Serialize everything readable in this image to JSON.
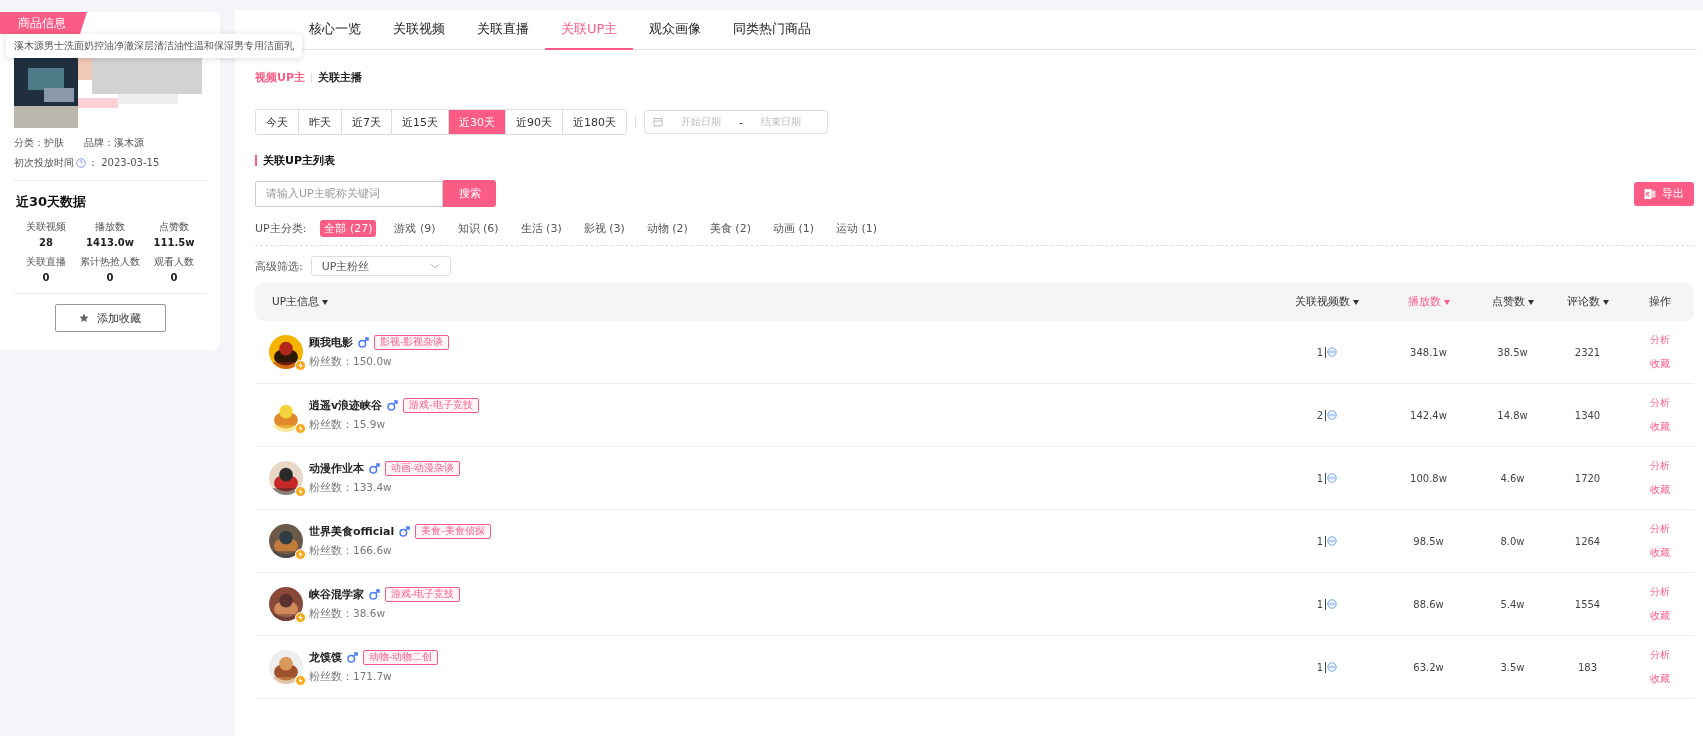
{
  "product": {
    "header": "商品信息",
    "tooltip": "溪木源男士洗面奶控油净澈深层清洁油性温和保湿男专用洁面乳",
    "category": "分类：护肤",
    "brand": "品牌：溪木源",
    "first_launch_label": "初次投放时间",
    "first_launch": "：  2023-03-15",
    "stats_title": "近30天数据",
    "stats": [
      {
        "label": "关联视频",
        "value": "28"
      },
      {
        "label": "播放数",
        "value": "1413.0w"
      },
      {
        "label": "点赞数",
        "value": "111.5w"
      },
      {
        "label": "关联直播",
        "value": "0"
      },
      {
        "label": "累计热抢人数",
        "value": "0"
      },
      {
        "label": "观看人数",
        "value": "0"
      }
    ],
    "favorite_button": "添加收藏"
  },
  "tabs": [
    {
      "label": "核心一览",
      "selected": false
    },
    {
      "label": "关联视频",
      "selected": false
    },
    {
      "label": "关联直播",
      "selected": false
    },
    {
      "label": "关联UP主",
      "selected": true
    },
    {
      "label": "观众画像",
      "selected": false
    },
    {
      "label": "同类热门商品",
      "selected": false
    }
  ],
  "sub_tabs": [
    {
      "label": "视频UP主",
      "selected": true
    },
    {
      "label": "关联主播",
      "selected": false
    }
  ],
  "date_ranges": [
    {
      "label": "今天",
      "selected": false
    },
    {
      "label": "昨天",
      "selected": false
    },
    {
      "label": "近7天",
      "selected": false
    },
    {
      "label": "近15天",
      "selected": false
    },
    {
      "label": "近30天",
      "selected": true
    },
    {
      "label": "近90天",
      "selected": false
    },
    {
      "label": "近180天",
      "selected": false
    }
  ],
  "date_picker": {
    "start_placeholder": "开始日期",
    "separator": "-",
    "end_placeholder": "结束日期"
  },
  "section_title": "关联UP主列表",
  "search": {
    "placeholder": "请输入UP主昵称关键词",
    "button": "搜索"
  },
  "export_button": "导出",
  "category_filter": {
    "label": "UP主分类:",
    "items": [
      {
        "label": "全部 (27)",
        "selected": true
      },
      {
        "label": "游戏 (9)",
        "selected": false
      },
      {
        "label": "知识 (6)",
        "selected": false
      },
      {
        "label": "生活 (3)",
        "selected": false
      },
      {
        "label": "影视 (3)",
        "selected": false
      },
      {
        "label": "动物 (2)",
        "selected": false
      },
      {
        "label": "美食 (2)",
        "selected": false
      },
      {
        "label": "动画 (1)",
        "selected": false
      },
      {
        "label": "运动 (1)",
        "selected": false
      }
    ]
  },
  "advanced_filter": {
    "label": "高级筛选:",
    "value": "UP主粉丝"
  },
  "table": {
    "columns": [
      {
        "label": "UP主信息",
        "sortable": true,
        "selected": false
      },
      {
        "label": "关联视频数",
        "sortable": true,
        "selected": false
      },
      {
        "label": "播放数",
        "sortable": true,
        "selected": true
      },
      {
        "label": "点赞数",
        "sortable": true,
        "selected": false
      },
      {
        "label": "评论数",
        "sortable": true,
        "selected": false
      },
      {
        "label": "操作",
        "sortable": false,
        "selected": false
      }
    ],
    "rows": [
      {
        "name": "顾我电影",
        "tag": "影视-影视杂谈",
        "fans": "粉丝数：150.0w",
        "videos": "1",
        "plays": "348.1w",
        "likes": "38.5w",
        "comments": "2321",
        "actions": [
          "分析",
          "收藏"
        ]
      },
      {
        "name": "逍遥v浪迹峡谷",
        "tag": "游戏-电子竞技",
        "fans": "粉丝数：15.9w",
        "videos": "2",
        "plays": "142.4w",
        "likes": "14.8w",
        "comments": "1340",
        "actions": [
          "分析",
          "收藏"
        ]
      },
      {
        "name": "动漫作业本",
        "tag": "动画-动漫杂谈",
        "fans": "粉丝数：133.4w",
        "videos": "1",
        "plays": "100.8w",
        "likes": "4.6w",
        "comments": "1720",
        "actions": [
          "分析",
          "收藏"
        ]
      },
      {
        "name": "世界美食official",
        "tag": "美食-美食侦探",
        "fans": "粉丝数：166.6w",
        "videos": "1",
        "plays": "98.5w",
        "likes": "8.0w",
        "comments": "1264",
        "actions": [
          "分析",
          "收藏"
        ]
      },
      {
        "name": "峡谷混学家",
        "tag": "游戏-电子竞技",
        "fans": "粉丝数：38.6w",
        "videos": "1",
        "plays": "88.6w",
        "likes": "5.4w",
        "comments": "1554",
        "actions": [
          "分析",
          "收藏"
        ]
      },
      {
        "name": "龙馍馍",
        "tag": "动物-动物二创",
        "fans": "粉丝数：171.7w",
        "videos": "1",
        "plays": "63.2w",
        "likes": "3.5w",
        "comments": "183",
        "actions": [
          "分析",
          "收藏"
        ]
      }
    ]
  }
}
